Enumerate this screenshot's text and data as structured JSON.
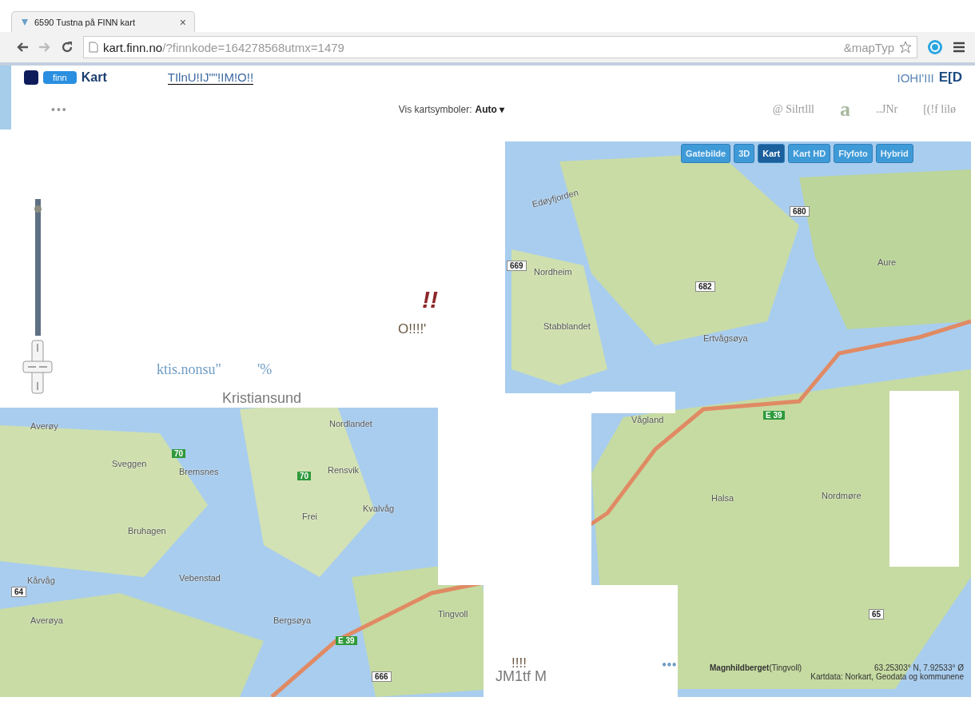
{
  "browser": {
    "tab_title": "6590 Tustna på FINN kart",
    "tab_close": "×",
    "url_host": "kart.finn.no",
    "url_rest": "/?finnkode=164278568utmx=1479",
    "url_tail": "&mapTyp"
  },
  "header": {
    "logo": "finn",
    "title": "Kart",
    "link": "TIlnU!IJ\"\"!IM!O!!",
    "right_1": "IOHI'III",
    "right_2": "E[D"
  },
  "toolbar": {
    "dots": "•••",
    "symbols_label": "Vis kartsymboler:",
    "symbols_value": "Auto ▾",
    "items": [
      "@ Silrtlll",
      "a",
      "..JNr",
      "[(!f lilø"
    ]
  },
  "map_types": [
    {
      "label": "Gatebilde",
      "selected": false
    },
    {
      "label": "3D",
      "selected": false
    },
    {
      "label": "Kart",
      "selected": true
    },
    {
      "label": "Kart HD",
      "selected": false
    },
    {
      "label": "Flyfoto",
      "selected": false
    },
    {
      "label": "Hybrid",
      "selected": false
    }
  ],
  "zoom": {
    "level": 0.95
  },
  "map": {
    "places": [
      "Edøyfjorden",
      "Aure",
      "Nordheim",
      "Stabblandet",
      "Ertvågsøya",
      "Halsa",
      "Nordmøre",
      "Averøy",
      "Averøya",
      "Frei",
      "Tingvoll",
      "Bergsøya",
      "Rensvik",
      "Kvalvåg",
      "Nordlandet",
      "Vågland",
      "Bremsnes",
      "Bruhagen",
      "Vebenstad",
      "Kårvåg",
      "Sveggen"
    ],
    "roads": [
      {
        "number": "680",
        "kind": "white"
      },
      {
        "number": "682",
        "kind": "white"
      },
      {
        "number": "669",
        "kind": "white"
      },
      {
        "number": "E 39",
        "kind": "green"
      },
      {
        "number": "E 39",
        "kind": "green"
      },
      {
        "number": "70",
        "kind": "green"
      },
      {
        "number": "70",
        "kind": "green"
      },
      {
        "number": "666",
        "kind": "white"
      },
      {
        "number": "65",
        "kind": "white"
      },
      {
        "number": "64",
        "kind": "white"
      }
    ]
  },
  "stray_texts": [
    {
      "text": "!!",
      "kind": "red"
    },
    {
      "text": "O!!!!'",
      "kind": "dark"
    },
    {
      "text": "ktis.nonsu\"",
      "kind": "blue"
    },
    {
      "text": "'%",
      "kind": "blue"
    },
    {
      "text": "Kristiansund",
      "kind": "grey"
    },
    {
      "text": "!!!!",
      "kind": "dark"
    },
    {
      "text": "JM1tf M",
      "kind": "grey"
    },
    {
      "text": "•••",
      "kind": "blue"
    }
  ],
  "attribution": {
    "place": "Magnhildberget",
    "municipality": "(Tingvoll)",
    "coords": "63.25303° N, 7.92533° Ø",
    "credit": "Kartdata: Norkart, Geodata og kommunene"
  }
}
